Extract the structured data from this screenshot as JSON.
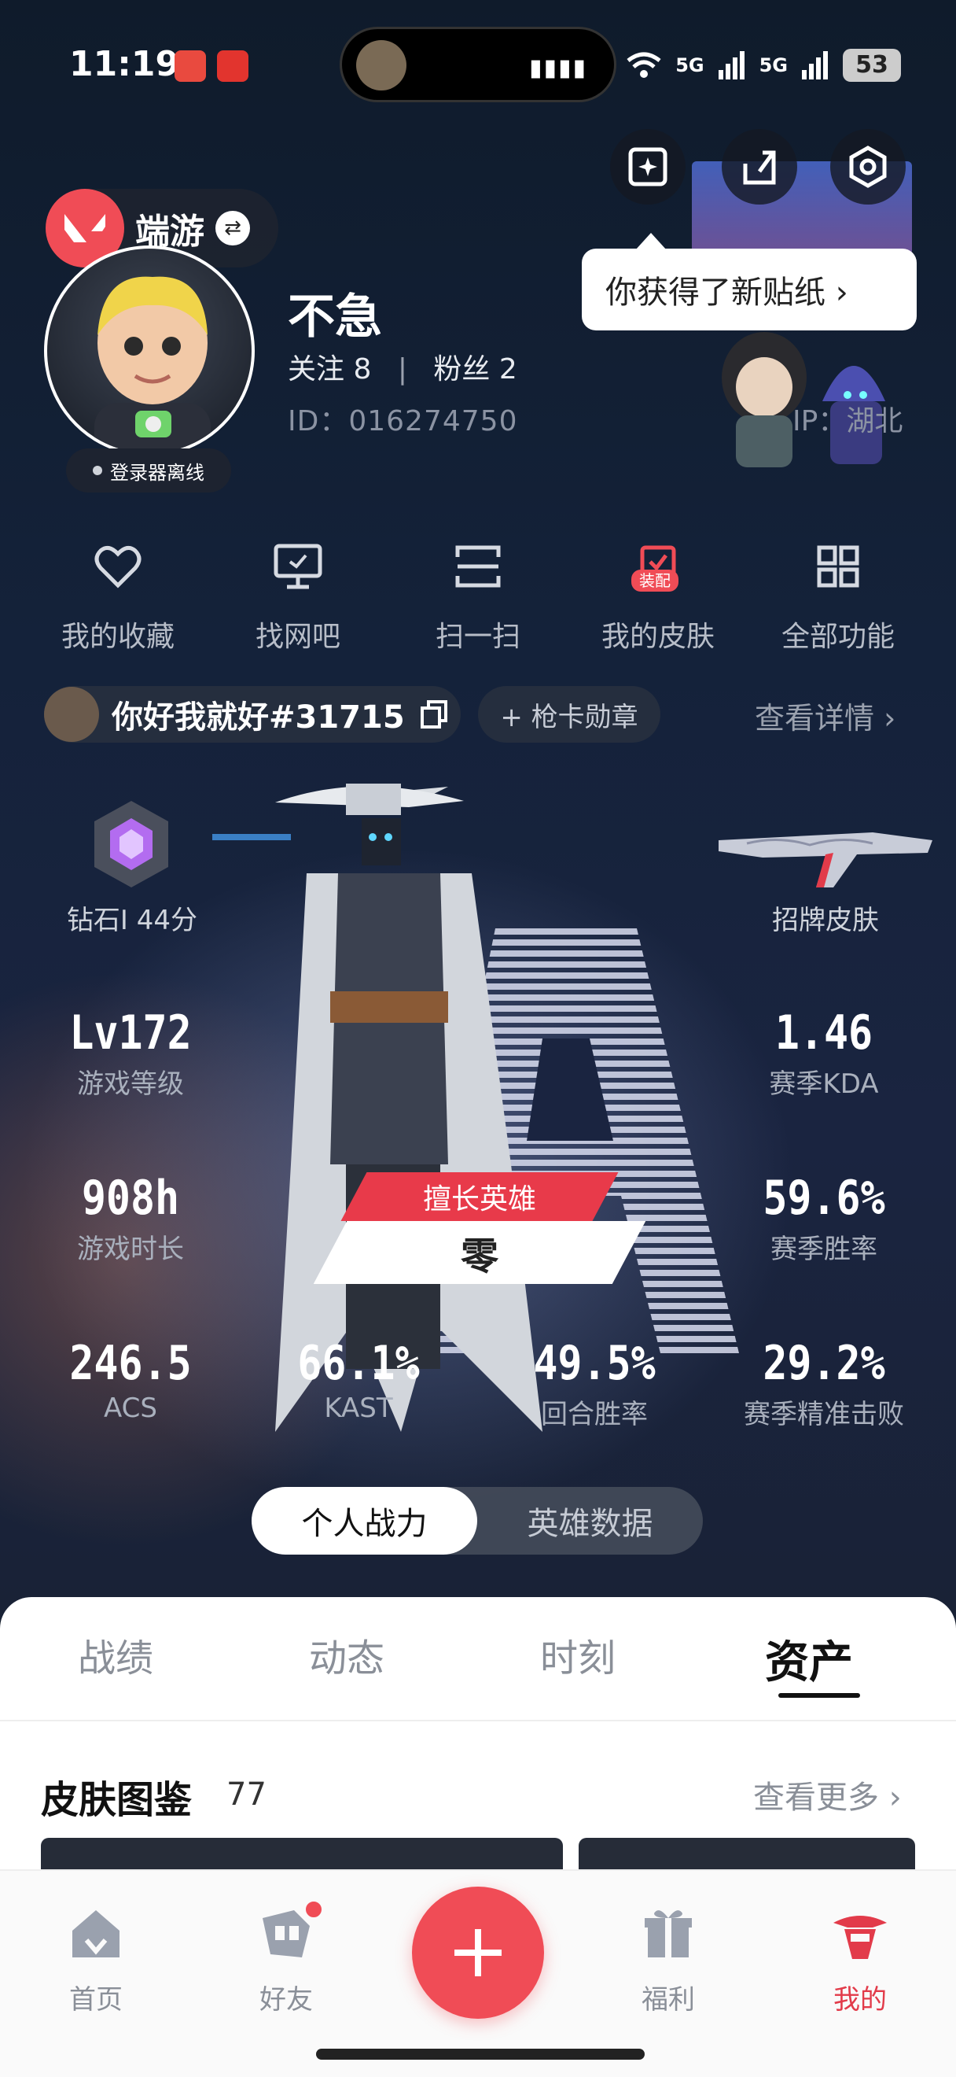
{
  "status_bar": {
    "time": "11:19",
    "network1": "5G",
    "network2": "5G",
    "battery": "53"
  },
  "header": {
    "brand_name": "端游",
    "tooltip": "你获得了新贴纸 ›"
  },
  "profile": {
    "username": "不急",
    "follow_label": "关注",
    "follow_count": "8",
    "fans_label": "粉丝",
    "fans_count": "2",
    "follow_text": "关注 8  |  粉丝 2",
    "id_text": "ID：016274750",
    "ip_text": "IP：湖北",
    "launcher_status": "登录器离线"
  },
  "quick_menu": [
    {
      "label": "我的收藏",
      "icon": "heart-icon"
    },
    {
      "label": "找网吧",
      "icon": "monitor-icon"
    },
    {
      "label": "扫一扫",
      "icon": "scan-icon"
    },
    {
      "label": "我的皮肤",
      "icon": "skin-icon",
      "badge": "装配"
    },
    {
      "label": "全部功能",
      "icon": "grid-icon"
    }
  ],
  "account": {
    "riot_id": "你好我就好#31715",
    "medal_button": "+ 枪卡勋章",
    "details_link": "查看详情 ›"
  },
  "stats": {
    "rank": "钻石I 44分",
    "signature_skin": "招牌皮肤",
    "level": {
      "value": "Lv172",
      "label": "游戏等级"
    },
    "kda": {
      "value": "1.46",
      "label": "赛季KDA"
    },
    "hours": {
      "value": "908h",
      "label": "游戏时长"
    },
    "winrate": {
      "value": "59.6%",
      "label": "赛季胜率"
    },
    "acs": {
      "value": "246.5",
      "label": "ACS"
    },
    "kast": {
      "value": "66.1%",
      "label": "KAST"
    },
    "round_winrate": {
      "value": "49.5%",
      "label": "回合胜率"
    },
    "headshot": {
      "value": "29.2%",
      "label": "赛季精准击败"
    },
    "best_agent_label": "擅长英雄",
    "best_agent": "零"
  },
  "toggle": {
    "personal": "个人战力",
    "agent_data": "英雄数据"
  },
  "tabs": [
    "战绩",
    "动态",
    "时刻",
    "资产"
  ],
  "skins_section": {
    "title": "皮肤图鉴",
    "count": "77",
    "more": "查看更多 ›"
  },
  "bottom_nav": {
    "home": "首页",
    "friends": "好友",
    "welfare": "福利",
    "mine": "我的"
  },
  "colors": {
    "accent": "#f04c56",
    "dark_bg": "#0f1b2b",
    "active_nav": "#e23b4a"
  }
}
